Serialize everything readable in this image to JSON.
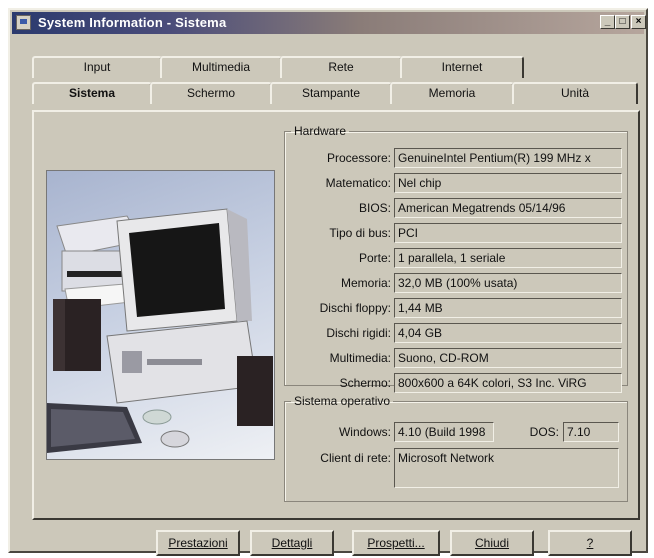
{
  "window": {
    "title": "System Information - Sistema",
    "controls": [
      "_",
      "□",
      "×"
    ]
  },
  "tabs_back": [
    "Input",
    "Multimedia",
    "Rete",
    "Internet"
  ],
  "tabs_front": [
    "Sistema",
    "Schermo",
    "Stampante",
    "Memoria",
    "Unità"
  ],
  "hardware": {
    "legend": "Hardware",
    "rows": [
      {
        "label": "Processore:",
        "value": "GenuineIntel Pentium(R) 199 MHz x"
      },
      {
        "label": "Matematico:",
        "value": "Nel chip"
      },
      {
        "label": "BIOS:",
        "value": "American Megatrends 05/14/96"
      },
      {
        "label": "Tipo di bus:",
        "value": "PCI"
      },
      {
        "label": "Porte:",
        "value": "1 parallela, 1 seriale"
      },
      {
        "label": "Memoria:",
        "value": "32,0 MB  (100% usata)"
      },
      {
        "label": "Dischi floppy:",
        "value": "1,44 MB"
      },
      {
        "label": "Dischi rigidi:",
        "value": "4,04 GB"
      },
      {
        "label": "Multimedia:",
        "value": "Suono, CD-ROM"
      },
      {
        "label": "Schermo:",
        "value": "800x600 a 64K colori,  S3 Inc. ViRG"
      }
    ]
  },
  "os": {
    "legend": "Sistema operativo",
    "windows_label": "Windows:",
    "windows_value": "4.10 (Build 1998",
    "dos_label": "DOS:",
    "dos_value": "7.10",
    "client_label": "Client di rete:",
    "client_value": "Microsoft Network"
  },
  "buttons": [
    "Prestazioni",
    "Dettagli",
    "Prospetti...",
    "Chiudi",
    "?"
  ]
}
